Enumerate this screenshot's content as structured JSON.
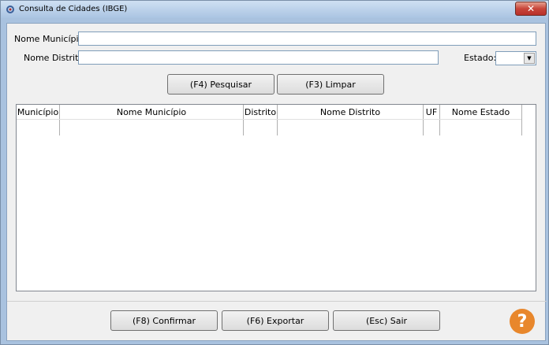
{
  "window": {
    "title": "Consulta de Cidades (IBGE)"
  },
  "form": {
    "municipio_label": "Nome Município:",
    "municipio_value": "",
    "distrito_label": "Nome Distrito:",
    "distrito_value": "",
    "estado_label": "Estado:",
    "estado_value": ""
  },
  "buttons": {
    "pesquisar": "(F4) Pesquisar",
    "limpar": "(F3) Limpar",
    "confirmar": "(F8) Confirmar",
    "exportar": "(F6) Exportar",
    "sair": "(Esc) Sair"
  },
  "grid": {
    "columns": [
      "Município",
      "Nome Município",
      "Distrito",
      "Nome Distrito",
      "UF",
      "Nome Estado"
    ],
    "rows": []
  },
  "icons": {
    "app": "app-icon",
    "help": "help-icon"
  },
  "colors": {
    "help": "#e8872c",
    "close": "#c8453a"
  }
}
